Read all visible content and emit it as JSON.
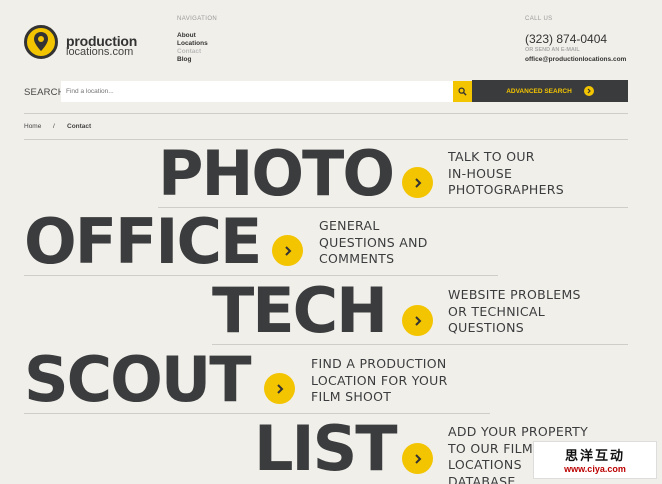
{
  "header": {
    "logo_line1": "production",
    "logo_line2": "locations.com",
    "nav_heading": "NAVIGATION",
    "nav_items": [
      {
        "label": "About",
        "active": false
      },
      {
        "label": "Locations",
        "active": false
      },
      {
        "label": "Contact",
        "active": true
      },
      {
        "label": "Blog",
        "active": false
      }
    ],
    "call_heading": "CALL US",
    "phone": "(323) 874-0404",
    "email_heading": "OR SEND AN E-MAIL",
    "email": "office@productionlocations.com"
  },
  "search": {
    "label": "SEARCH:",
    "placeholder": "Find a location...",
    "advanced_label": "ADVANCED SEARCH"
  },
  "breadcrumb": {
    "home": "Home",
    "separator": "/",
    "current": "Contact"
  },
  "contacts": [
    {
      "word": "PHOTO",
      "desc1": "TALK TO OUR",
      "desc2": "IN-HOUSE",
      "desc3": "PHOTOGRAPHERS"
    },
    {
      "word": "OFFICE",
      "desc1": "GENERAL",
      "desc2": "QUESTIONS AND",
      "desc3": "COMMENTS"
    },
    {
      "word": "TECH",
      "desc1": "WEBSITE PROBLEMS",
      "desc2": "OR TECHNICAL",
      "desc3": "QUESTIONS"
    },
    {
      "word": "SCOUT",
      "desc1": "FIND A PRODUCTION",
      "desc2": "LOCATION FOR YOUR",
      "desc3": "FILM SHOOT"
    },
    {
      "word": "LIST",
      "desc1": "ADD YOUR PROPERTY",
      "desc2": "TO OUR FILM",
      "desc3": "LOCATIONS",
      "desc4": "DATABASE"
    }
  ],
  "watermark": {
    "cn": "思洋互动",
    "url": "www.ciya.com"
  },
  "colors": {
    "accent": "#f3c400",
    "dark": "#3a3b3d",
    "background": "#f1efea"
  }
}
